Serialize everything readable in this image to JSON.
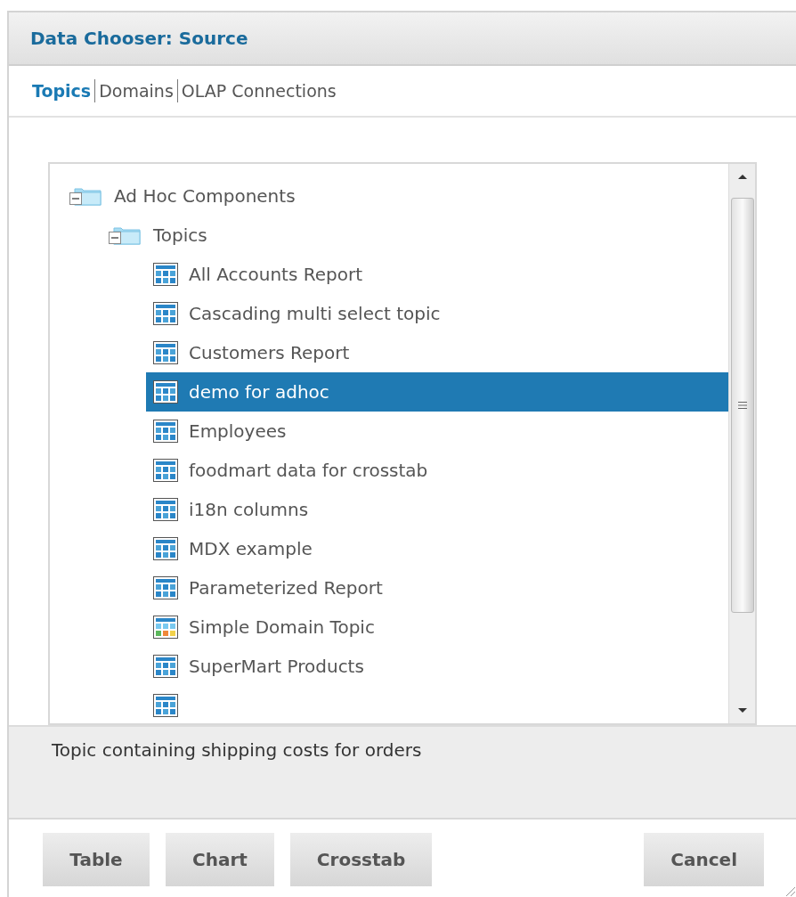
{
  "dialog": {
    "title": "Data Chooser: Source"
  },
  "tabs": [
    {
      "label": "Topics",
      "selected": true
    },
    {
      "label": "Domains",
      "selected": false
    },
    {
      "label": "OLAP Connections",
      "selected": false
    }
  ],
  "tree": [
    {
      "label": "Ad Hoc Components",
      "kind": "folder",
      "expanded": true,
      "selected": false,
      "children": [
        {
          "label": "Topics",
          "kind": "folder",
          "expanded": true,
          "selected": false,
          "children": [
            {
              "label": "All Accounts Report",
              "kind": "topic",
              "selected": false
            },
            {
              "label": "Cascading multi select topic",
              "kind": "topic",
              "selected": false
            },
            {
              "label": "Customers Report",
              "kind": "topic",
              "selected": false
            },
            {
              "label": "demo for adhoc",
              "kind": "topic",
              "selected": true
            },
            {
              "label": "Employees",
              "kind": "topic",
              "selected": false
            },
            {
              "label": "foodmart data for crosstab",
              "kind": "topic",
              "selected": false
            },
            {
              "label": "i18n columns",
              "kind": "topic",
              "selected": false
            },
            {
              "label": "MDX example",
              "kind": "topic",
              "selected": false
            },
            {
              "label": "Parameterized Report",
              "kind": "topic",
              "selected": false
            },
            {
              "label": "Simple Domain Topic",
              "kind": "domain",
              "selected": false
            },
            {
              "label": "SuperMart Products",
              "kind": "topic",
              "selected": false
            },
            {
              "kind": "topic",
              "selected": false
            }
          ]
        }
      ]
    }
  ],
  "description": "Topic containing shipping costs for orders",
  "buttons": [
    {
      "label": "Table",
      "kind": "left"
    },
    {
      "label": "Chart",
      "kind": "left"
    },
    {
      "label": "Crosstab",
      "kind": "left"
    },
    {
      "label": "Cancel",
      "kind": "right"
    }
  ]
}
